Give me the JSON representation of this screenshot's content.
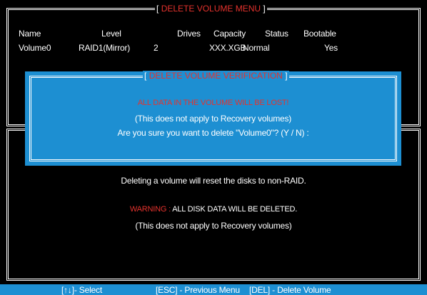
{
  "delete_volume_menu": {
    "title_open": "[",
    "title": "DELETE VOLUME MENU",
    "title_close": "]",
    "columns": [
      "Name",
      "Level",
      "Drives",
      "Capacity",
      "Status",
      "Bootable"
    ],
    "rows": [
      [
        "Volume0",
        "RAID1(Mirror)",
        "2",
        "XXX.XGB",
        "Normal",
        "Yes"
      ]
    ]
  },
  "verification_dialog": {
    "title_open": "[",
    "title": "DELETE VOLUME VERIFICATION",
    "title_close": "]",
    "warning": "ALL DATA IN THE VOLUME WILL BE LOST!",
    "note": "(This does not apply to Recovery volumes)",
    "prompt": "Are you sure you want to delete \"Volume0\"? (Y / N) :"
  },
  "info_panel": {
    "line1": "Deleting a volume will reset the disks to non-RAID.",
    "warning_label": "WARNING :",
    "warning_text": "ALL DISK DATA WILL BE DELETED.",
    "note": "(This does not apply to Recovery volumes)"
  },
  "footer": {
    "select_hint": "[↑↓]- Select",
    "esc_hint": "[ESC] - Previous Menu",
    "del_hint": "[DEL] - Delete Volume"
  },
  "colors": {
    "background": "#000000",
    "accent_blue": "#1d8fd2",
    "warning_red": "#e5322d",
    "text": "#ffffff"
  }
}
